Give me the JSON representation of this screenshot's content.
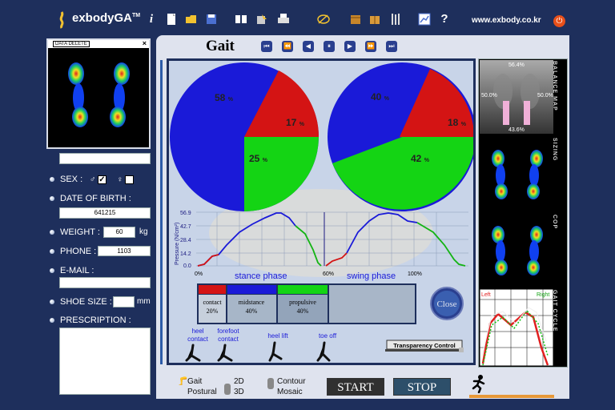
{
  "app": {
    "name": "exbodyGA",
    "tm": "TM",
    "site": "www.exbody.co.kr"
  },
  "toolbar_icons": [
    "info-icon",
    "document-icon",
    "folder-icon",
    "save-icon",
    "compare-icon",
    "export-icon",
    "print-icon",
    "signature-icon",
    "box-icon",
    "package-icon",
    "tools-icon",
    "chart-icon",
    "help-icon"
  ],
  "left": {
    "data_delete": "DATA DELETE",
    "name_value": "",
    "sex_label": "SEX :",
    "male_symbol": "♂",
    "female_symbol": "♀",
    "male_checked": true,
    "female_checked": false,
    "dob_label": "DATE OF BIRTH :",
    "dob_value": "641215",
    "weight_label": "WEIGHT :",
    "weight_value": "60",
    "weight_unit": "kg",
    "phone_label": "PHONE :",
    "phone_value": "1103",
    "email_label": "E-MAIL :",
    "email_value": "",
    "shoe_label": "SHOE SIZE :",
    "shoe_value": "",
    "shoe_unit": "mm",
    "prescription_label": "PRESCRIPTION :",
    "prescription_value": ""
  },
  "main": {
    "title": "Gait",
    "pie_left": {
      "blue": "58",
      "red": "17",
      "green": "25",
      "unit": "%"
    },
    "pie_right": {
      "blue": "40",
      "red": "18",
      "green": "42",
      "unit": "%"
    },
    "ylabel": "Pressure (N/cm²)",
    "yticks": [
      "56.9",
      "42.7",
      "28.4",
      "14.2",
      "0.0"
    ],
    "xticks": [
      "0%",
      "60%",
      "100%"
    ],
    "stance_label": "stance phase",
    "swing_label": "swing phase",
    "phases": [
      {
        "name": "contact",
        "pct": "20%"
      },
      {
        "name": "midstance",
        "pct": "40%"
      },
      {
        "name": "propulsive",
        "pct": "40%"
      }
    ],
    "events": [
      "heel contact",
      "forefoot contact",
      "heel lift",
      "toe off"
    ],
    "close_label": "Close",
    "transparency_label": "Transparency Control",
    "colors": {
      "blue": "#1a1ad8",
      "red": "#d41414",
      "green": "#14d414",
      "accent": "#1e2f5c"
    }
  },
  "right": {
    "balance_map_label": "BALANCE MAP",
    "balance_top": "56.4%",
    "balance_left": "50.0%",
    "balance_right": "50.0%",
    "balance_bottom": "43.6%",
    "sizing_label": "SIZING",
    "cop_label": "COP",
    "gait_cycle_label": "GAIT CYCLE",
    "gait_left": "Left",
    "gait_right": "Right"
  },
  "bottom": {
    "gait": "Gait",
    "postural": "Postural",
    "d2": "2D",
    "d3": "3D",
    "contour": "Contour",
    "mosaic": "Mosaic",
    "start": "START",
    "stop": "STOP"
  }
}
